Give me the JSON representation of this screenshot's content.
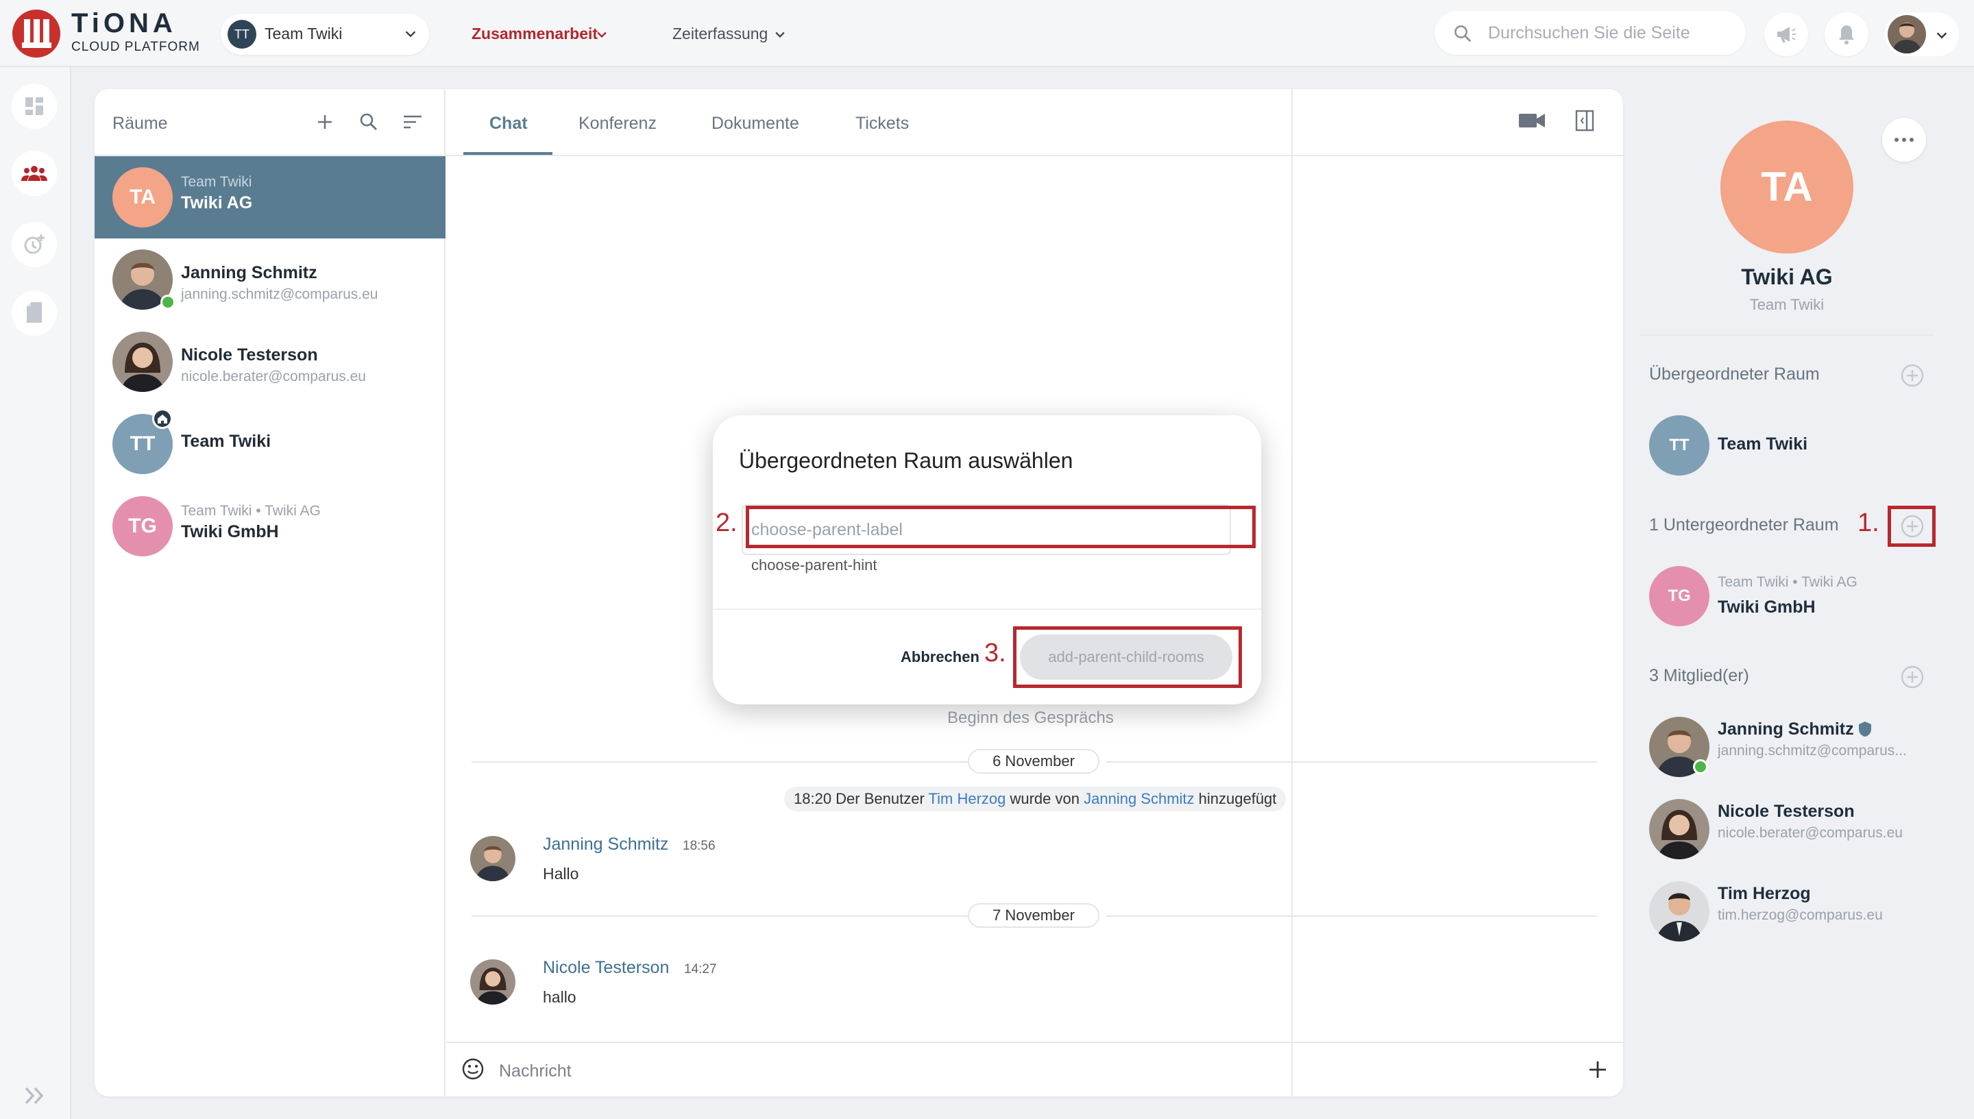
{
  "brand": {
    "title": "TiONA",
    "subtitle": "CLOUD PLATFORM",
    "color": "#c8302c"
  },
  "header": {
    "team_select": {
      "initials": "TT",
      "label": "Team Twiki"
    },
    "nav": [
      {
        "label": "Zusammenarbeit",
        "active": true
      },
      {
        "label": "Zeiterfassung",
        "active": false
      }
    ],
    "search_placeholder": "Durchsuchen Sie die Seite"
  },
  "rooms": {
    "title": "Räume",
    "items": [
      {
        "initials": "TA",
        "sub": "Team Twiki",
        "name": "Twiki AG",
        "active": true,
        "color": "#f4a487"
      },
      {
        "name": "Janning Schmitz",
        "mail": "janning.schmitz@comparus.eu",
        "online": true
      },
      {
        "name": "Nicole Testerson",
        "mail": "nicole.berater@comparus.eu"
      },
      {
        "initials": "TT",
        "name": "Team Twiki",
        "color": "#7f9fb5",
        "home": true
      },
      {
        "initials": "TG",
        "sub": "Team Twiki • Twiki AG",
        "name": "Twiki GmbH",
        "color": "#e48fad"
      }
    ]
  },
  "chat": {
    "tabs": [
      "Chat",
      "Konferenz",
      "Dokumente",
      "Tickets"
    ],
    "active_tab": "Chat",
    "begin_text": "Beginn des Gesprächs",
    "date1": "6 November",
    "system_message": {
      "prefix": "18:20 Der Benutzer ",
      "user1": "Tim Herzog",
      "middle": " wurde von ",
      "user2": "Janning Schmitz",
      "suffix": " hinzugefügt"
    },
    "messages": [
      {
        "author": "Janning Schmitz",
        "time": "18:56",
        "text": "Hallo"
      },
      {
        "author": "Nicole Testerson",
        "time": "14:27",
        "text": "hallo"
      }
    ],
    "date2": "7 November",
    "composer_placeholder": "Nachricht"
  },
  "details": {
    "initials": "TA",
    "name": "Twiki AG",
    "team": "Team Twiki",
    "parent_section": "Übergeordneter Raum",
    "parent": {
      "initials": "TT",
      "name": "Team Twiki"
    },
    "child_section": "1 Untergeordneter Raum",
    "child": {
      "initials": "TG",
      "sub": "Team Twiki • Twiki AG",
      "name": "Twiki GmbH"
    },
    "members_section": "3 Mitglied(er)",
    "members": [
      {
        "name": "Janning Schmitz",
        "mail": "janning.schmitz@comparus...",
        "admin": true,
        "online": true
      },
      {
        "name": "Nicole Testerson",
        "mail": "nicole.berater@comparus.eu"
      },
      {
        "name": "Tim Herzog",
        "mail": "tim.herzog@comparus.eu"
      }
    ]
  },
  "dialog": {
    "title": "Übergeordneten Raum auswählen",
    "input_placeholder": "choose-parent-label",
    "hint": "choose-parent-hint",
    "cancel": "Abbrechen",
    "submit": "add-parent-child-rooms"
  },
  "annotations": {
    "n1": "1.",
    "n2": "2.",
    "n3": "3.",
    "color": "#b8282e"
  }
}
